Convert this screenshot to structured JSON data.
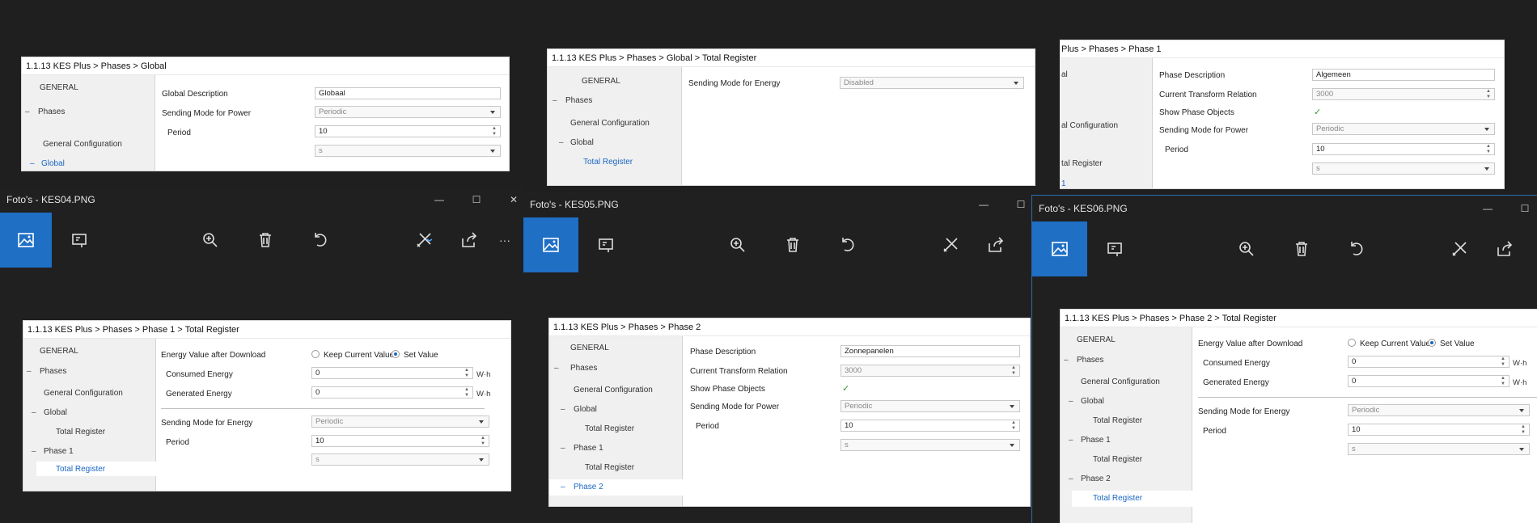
{
  "colors": {
    "accent": "#1f6fc5",
    "selected": "#1a66c2",
    "background": "#1f1f1f"
  },
  "windows": [
    {
      "title": "Foto's - KES04.PNG"
    },
    {
      "title": "Foto's - KES05.PNG"
    },
    {
      "title": "Foto's - KES06.PNG"
    }
  ],
  "window_controls": {
    "minimize": "—",
    "maximize": "☐",
    "close": "✕"
  },
  "toolbar_icons": [
    "image-icon",
    "slideshow-icon",
    "zoom-in-icon",
    "delete-icon",
    "rotate-icon",
    "edit-icon",
    "share-icon"
  ],
  "more": "···",
  "tree": {
    "general": "GENERAL",
    "phases": "Phases",
    "general_configuration": "General Configuration",
    "global": "Global",
    "total_register": "Total Register",
    "phase1": "Phase 1",
    "phase2": "Phase 2",
    "minus": "–"
  },
  "panels": {
    "p1": {
      "breadcrumb": "1.1.13 KES Plus > Phases > Global",
      "global_description_label": "Global Description",
      "global_description_value": "Globaal",
      "sending_mode_power_label": "Sending Mode for Power",
      "sending_mode_power_value": "Periodic",
      "period_label": "Period",
      "period_value": "10",
      "period_unit": "s"
    },
    "p2": {
      "breadcrumb": "1.1.13 KES Plus > Phases > Global > Total Register",
      "sending_mode_energy_label": "Sending Mode for Energy",
      "sending_mode_energy_value": "Disabled"
    },
    "p3": {
      "breadcrumb": "Plus > Phases > Phase 1",
      "tree_fragments": [
        "al",
        "al Configuration",
        "tal Register",
        "1"
      ],
      "phase_description_label": "Phase Description",
      "phase_description_value": "Algemeen",
      "ct_label": "Current Transform Relation",
      "ct_value": "3000",
      "show_phase_label": "Show Phase Objects",
      "check": "✓",
      "sending_mode_power_label": "Sending Mode for Power",
      "sending_mode_power_value": "Periodic",
      "period_label": "Period",
      "period_value": "10",
      "period_unit": "s"
    },
    "p4": {
      "breadcrumb": "1.1.13 KES Plus > Phases > Phase 1 > Total Register",
      "energy_after_download_label": "Energy Value after Download",
      "keep_label": "Keep Current Value",
      "set_label": "Set Value",
      "consumed_label": "Consumed Energy",
      "consumed_value": "0",
      "generated_label": "Generated Energy",
      "generated_value": "0",
      "unit": "W·h",
      "sending_mode_energy_label": "Sending Mode for Energy",
      "sending_mode_energy_value": "Periodic",
      "period_label": "Period",
      "period_value": "10",
      "period_unit": "s"
    },
    "p5": {
      "breadcrumb": "1.1.13 KES Plus > Phases > Phase 2",
      "phase_description_label": "Phase Description",
      "phase_description_value": "Zonnepanelen",
      "ct_label": "Current Transform Relation",
      "ct_value": "3000",
      "show_phase_label": "Show Phase Objects",
      "check": "✓",
      "sending_mode_power_label": "Sending Mode for Power",
      "sending_mode_power_value": "Periodic",
      "period_label": "Period",
      "period_value": "10",
      "period_unit": "s"
    },
    "p6": {
      "breadcrumb": "1.1.13 KES Plus > Phases > Phase 2 > Total Register",
      "energy_after_download_label": "Energy Value after Download",
      "keep_label": "Keep Current Value",
      "set_label": "Set Value",
      "consumed_label": "Consumed Energy",
      "consumed_value": "0",
      "generated_label": "Generated Energy",
      "generated_value": "0",
      "unit": "W·h",
      "sending_mode_energy_label": "Sending Mode for Energy",
      "sending_mode_energy_value": "Periodic",
      "period_label": "Period",
      "period_value": "10",
      "period_unit": "s"
    }
  }
}
